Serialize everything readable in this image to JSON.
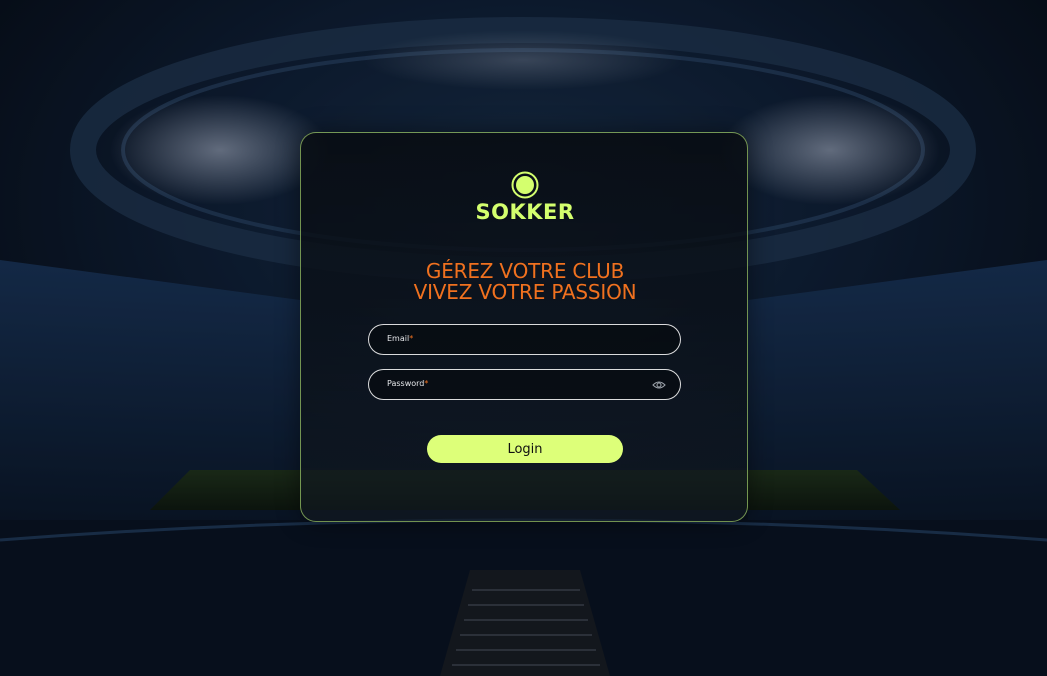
{
  "brand": {
    "name": "SOKKER",
    "logo_icon": "ball-icon",
    "accent_color": "#d4ff6e"
  },
  "tagline": {
    "line1": "GÉREZ VOTRE CLUB",
    "line2": "VIVEZ VOTRE PASSION",
    "color": "#f0711f"
  },
  "form": {
    "email": {
      "label": "Email",
      "required_mark": "*",
      "value": ""
    },
    "password": {
      "label": "Password",
      "required_mark": "*",
      "value": "",
      "toggle_icon": "eye-icon"
    },
    "submit_label": "Login",
    "button_color": "#ddff79"
  }
}
